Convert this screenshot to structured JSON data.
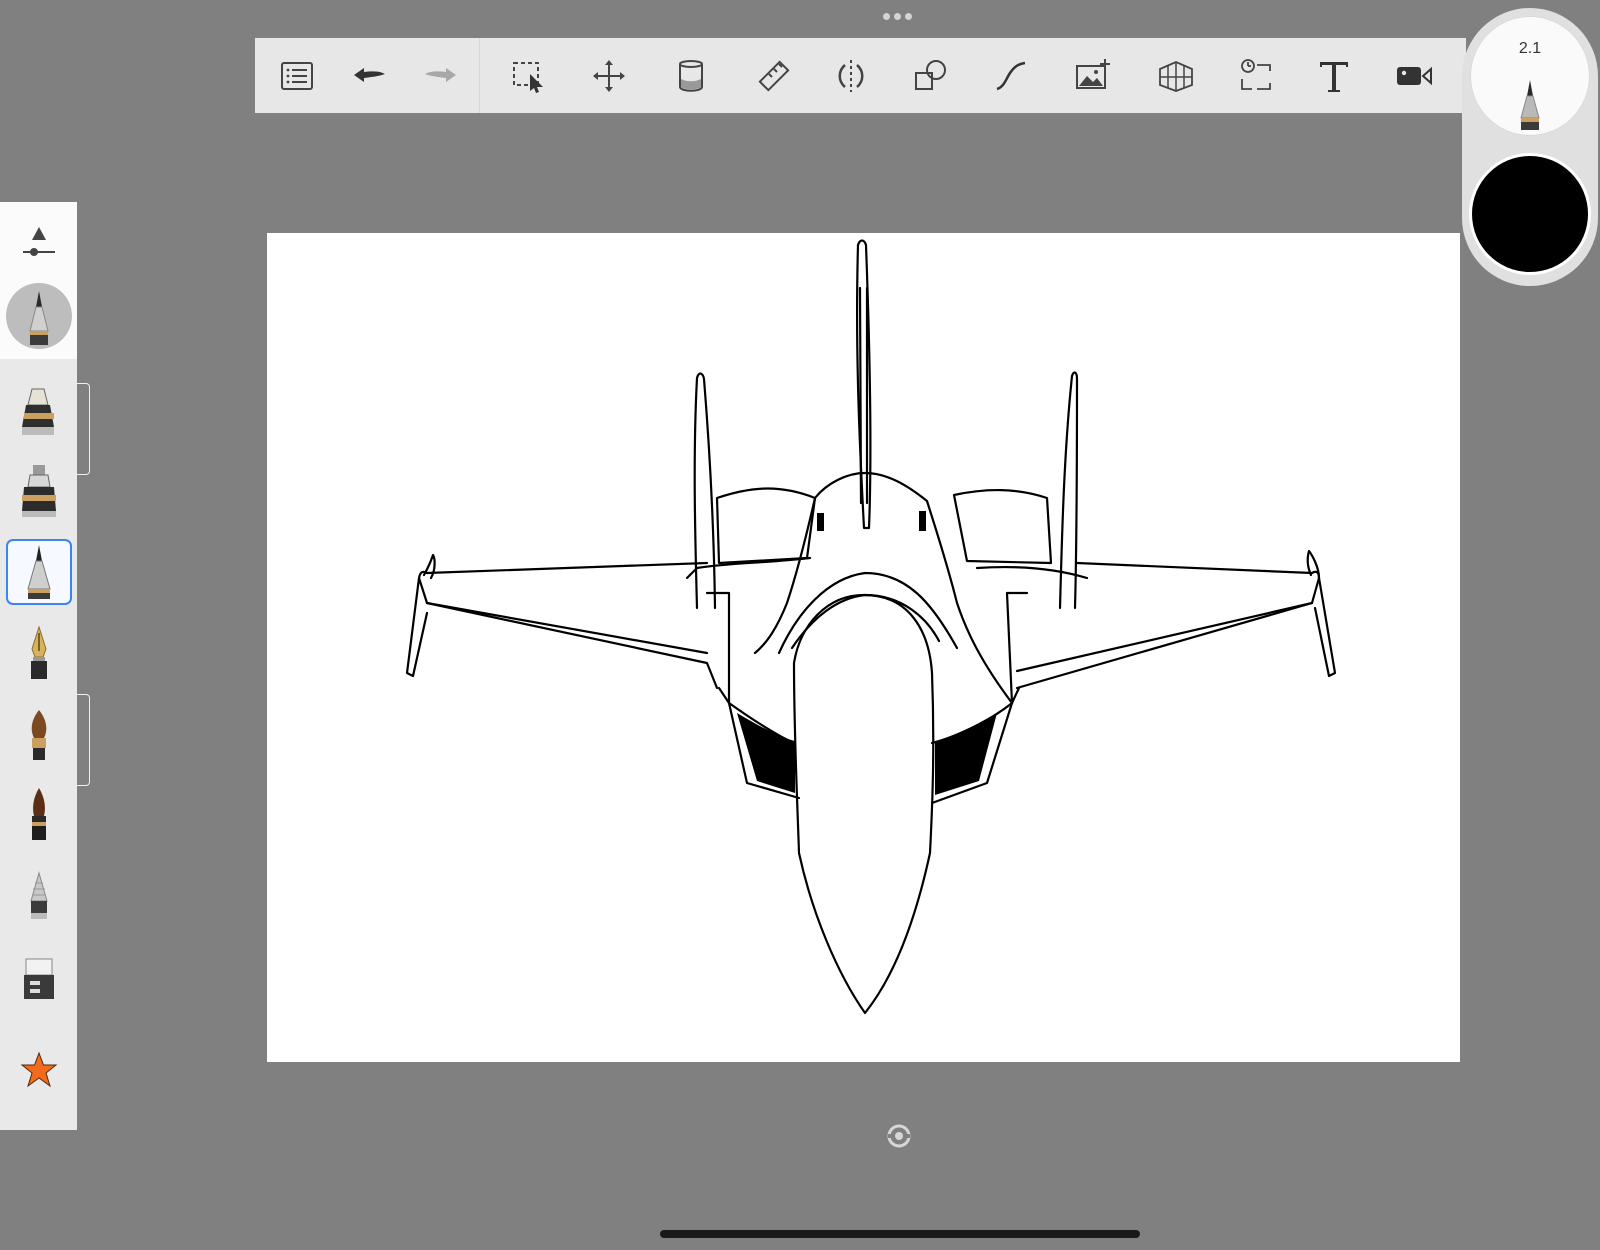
{
  "app": {
    "brush_size": "2.1",
    "current_color": "#000000",
    "accent_color": "#3a86f0"
  },
  "toolbar": {
    "items": [
      {
        "name": "list-icon"
      },
      {
        "name": "undo-icon"
      },
      {
        "name": "redo-icon"
      },
      {
        "name": "selection-icon"
      },
      {
        "name": "transform-icon"
      },
      {
        "name": "fill-icon"
      },
      {
        "name": "ruler-icon"
      },
      {
        "name": "symmetry-icon"
      },
      {
        "name": "shapes-icon"
      },
      {
        "name": "curve-icon"
      },
      {
        "name": "import-image-icon"
      },
      {
        "name": "perspective-icon"
      },
      {
        "name": "time-lapse-icon"
      },
      {
        "name": "text-icon"
      },
      {
        "name": "video-icon"
      }
    ]
  },
  "palette": {
    "brushes": [
      {
        "name": "marker-brush"
      },
      {
        "name": "airbrush-brush"
      },
      {
        "name": "ballpoint-pen-brush",
        "selected": true
      },
      {
        "name": "fountain-pen-brush"
      },
      {
        "name": "paint-brush"
      },
      {
        "name": "ink-brush"
      },
      {
        "name": "pencil-brush"
      },
      {
        "name": "eraser-brush"
      },
      {
        "name": "favorites-star"
      }
    ]
  }
}
